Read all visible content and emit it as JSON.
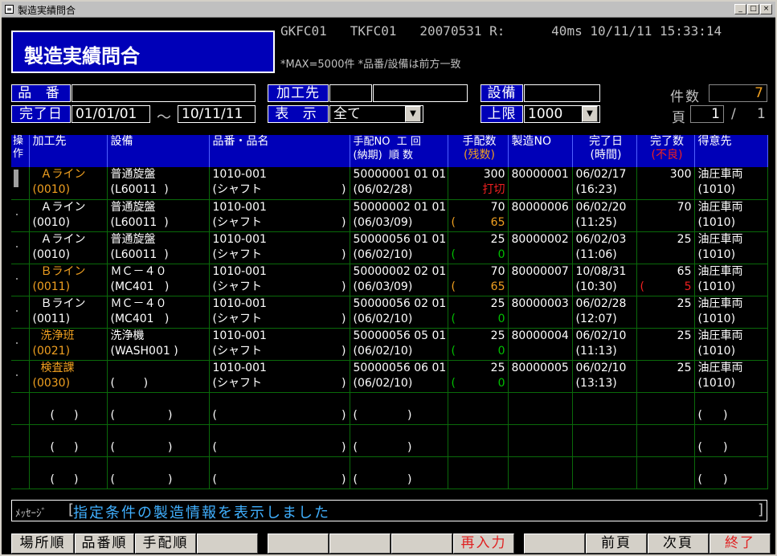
{
  "window": {
    "title": "製造実績問合"
  },
  "header": {
    "app_title": "製造実績問合",
    "sys1": "GKFC01",
    "sys2": "TKFC01",
    "sys3": "20070531 R:",
    "ms": "40ms",
    "datetime": "10/11/11 15:33:14",
    "note": "*MAX=5000件 *品番/設備は前方一致"
  },
  "form": {
    "hinban_label": "品 番",
    "kakousaki_label": "加工先",
    "setsubi_label": "設備",
    "kensu_label": "件数",
    "kensu": "7",
    "kanryobi_label": "完了日",
    "from_date": "01/01/01",
    "tilde": "～",
    "to_date": "10/11/11",
    "hyouji_label": "表 示",
    "hyouji_value": "全て",
    "jogen_label": "上限",
    "jogen_value": "1000",
    "page_label": "頁",
    "page": "1",
    "slash": "/",
    "page_total": "1"
  },
  "grid": {
    "headers": {
      "c0": "操作",
      "c1": "加工先",
      "c2": "設備",
      "c3": "品番・品名",
      "c4a": "手配NO  工 回",
      "c4b": "(納期)  順 数",
      "c5a": "手配数",
      "c5b": "(残数)",
      "c6": "製造NO",
      "c7a": "完了日",
      "c7b": "(時間)",
      "c8a": "完了数",
      "c8b": "(不良)",
      "c9": "得意先"
    },
    "rows": [
      {
        "kakou": "Ａライン",
        "kcode": "(0010)",
        "setsubi": "普通旋盤",
        "scode": "(L60011  )",
        "hin": "1010-001",
        "hname": "(シャフト",
        "tehai": "50000001 01 01",
        "nouki": "(06/02/28)",
        "qty": "300",
        "remain": "打切",
        "seizo": "80000001",
        "kdate": "06/02/17",
        "ktime": "(16:23)",
        "kqty": "300",
        "furyo": "",
        "tokui": "油圧車両",
        "tcode": "(1010)"
      },
      {
        "kakou": "Ａライン",
        "kcode": "(0010)",
        "setsubi": "普通旋盤",
        "scode": "(L60011  )",
        "hin": "1010-001",
        "hname": "(シャフト",
        "tehai": "50000002 01 01",
        "nouki": "(06/03/09)",
        "qty": "70",
        "remain": "65",
        "seizo": "80000006",
        "kdate": "06/02/20",
        "ktime": "(11:25)",
        "kqty": "70",
        "furyo": "",
        "tokui": "油圧車両",
        "tcode": "(1010)"
      },
      {
        "kakou": "Ａライン",
        "kcode": "(0010)",
        "setsubi": "普通旋盤",
        "scode": "(L60011  )",
        "hin": "1010-001",
        "hname": "(シャフト",
        "tehai": "50000056 01 01",
        "nouki": "(06/02/10)",
        "qty": "25",
        "remain": "0",
        "seizo": "80000002",
        "kdate": "06/02/03",
        "ktime": "(11:06)",
        "kqty": "25",
        "furyo": "",
        "tokui": "油圧車両",
        "tcode": "(1010)"
      },
      {
        "kakou": "Ｂライン",
        "kcode": "(0011)",
        "setsubi": "ＭＣ－４０",
        "scode": "(MC401   )",
        "hin": "1010-001",
        "hname": "(シャフト",
        "tehai": "50000002 02 01",
        "nouki": "(06/03/09)",
        "qty": "70",
        "remain": "65",
        "seizo": "80000007",
        "kdate": "10/08/31",
        "ktime": "(10:30)",
        "kqty": "65",
        "furyo": "5",
        "tokui": "油圧車両",
        "tcode": "(1010)"
      },
      {
        "kakou": "Ｂライン",
        "kcode": "(0011)",
        "setsubi": "ＭＣ－４０",
        "scode": "(MC401   )",
        "hin": "1010-001",
        "hname": "(シャフト",
        "tehai": "50000056 02 01",
        "nouki": "(06/02/10)",
        "qty": "25",
        "remain": "0",
        "seizo": "80000003",
        "kdate": "06/02/28",
        "ktime": "(12:07)",
        "kqty": "25",
        "furyo": "",
        "tokui": "油圧車両",
        "tcode": "(1010)"
      },
      {
        "kakou": "洗浄班",
        "kcode": "(0021)",
        "setsubi": "洗浄機",
        "scode": "(WASH001 )",
        "hin": "1010-001",
        "hname": "(シャフト",
        "tehai": "50000056 05 01",
        "nouki": "(06/02/10)",
        "qty": "25",
        "remain": "0",
        "seizo": "80000004",
        "kdate": "06/02/10",
        "ktime": "(11:13)",
        "kqty": "25",
        "furyo": "",
        "tokui": "油圧車両",
        "tcode": "(1010)"
      },
      {
        "kakou": "検査課",
        "kcode": "(0030)",
        "setsubi": "",
        "scode": "(        )",
        "hin": "1010-001",
        "hname": "(シャフト",
        "tehai": "50000056 06 01",
        "nouki": "(06/02/10)",
        "qty": "25",
        "remain": "0",
        "seizo": "80000005",
        "kdate": "06/02/10",
        "ktime": "(13:13)",
        "kqty": "25",
        "furyo": "",
        "tokui": "油圧車両",
        "tcode": "(1010)"
      }
    ],
    "paren_open": "(",
    "paren_close": ")"
  },
  "message": {
    "label": "ﾒｯｾｰｼﾞ",
    "open": "[",
    "text": "指定条件の製造情報を表示しました",
    "close": "]"
  },
  "fkeys": {
    "f1": "場所順",
    "f2": "品番順",
    "f3": "手配順",
    "f4": "",
    "f5": "",
    "f6": "",
    "f7": "",
    "f8": "再入力",
    "f9": "",
    "f10": "前頁",
    "f11": "次頁",
    "f12": "終了"
  },
  "colors": {
    "header_blue": "#0000b8",
    "grid_line": "#0a6a0a",
    "orange": "#f0a020",
    "red": "#f02020",
    "green": "#00c000",
    "msg_blue": "#40b0ff"
  }
}
